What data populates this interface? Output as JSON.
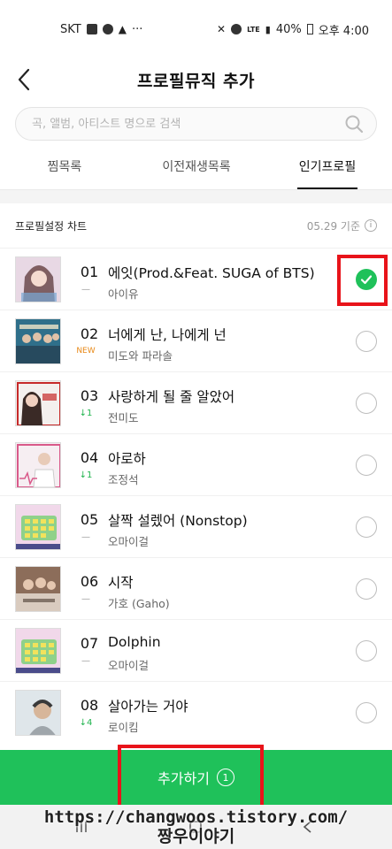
{
  "status_bar": {
    "carrier": "SKT",
    "left_dots": "···",
    "lte": "LTE",
    "battery": "40%",
    "time": "오후 4:00"
  },
  "header": {
    "title": "프로필뮤직 추가"
  },
  "search": {
    "placeholder": "곡, 앨범, 아티스트 명으로 검색"
  },
  "tabs": [
    {
      "label": "찜목록",
      "active": false
    },
    {
      "label": "이전재생목록",
      "active": false
    },
    {
      "label": "인기프로필",
      "active": true
    }
  ],
  "chart": {
    "title": "프로필설정 차트",
    "date": "05.29 기준",
    "info": "i"
  },
  "songs": [
    {
      "rank": "01",
      "change": "—",
      "change_type": "same",
      "title": "에잇(Prod.&Feat. SUGA of BTS)",
      "artist": "아이유",
      "selected": true
    },
    {
      "rank": "02",
      "change": "NEW",
      "change_type": "new",
      "title": "너에게 난, 나에게 넌",
      "artist": "미도와 파라솔",
      "selected": false
    },
    {
      "rank": "03",
      "change": "↓1",
      "change_type": "down",
      "title": "사랑하게 될 줄 알았어",
      "artist": "전미도",
      "selected": false
    },
    {
      "rank": "04",
      "change": "↓1",
      "change_type": "down",
      "title": "아로하",
      "artist": "조정석",
      "selected": false
    },
    {
      "rank": "05",
      "change": "—",
      "change_type": "same",
      "title": "살짝 설렜어 (Nonstop)",
      "artist": "오마이걸",
      "selected": false
    },
    {
      "rank": "06",
      "change": "—",
      "change_type": "same",
      "title": "시작",
      "artist": "가호 (Gaho)",
      "selected": false
    },
    {
      "rank": "07",
      "change": "—",
      "change_type": "same",
      "title": "Dolphin",
      "artist": "오마이걸",
      "selected": false
    },
    {
      "rank": "08",
      "change": "↓4",
      "change_type": "down",
      "title": "살아가는 거야",
      "artist": "로이킴",
      "selected": false
    }
  ],
  "add_button": {
    "label": "추가하기",
    "count": "1"
  },
  "watermark": {
    "line1": "https://changwoos.tistory.com/",
    "line2": "짱우이야기"
  },
  "colors": {
    "accent_green": "#1fc15a",
    "highlight_red": "#e8131a",
    "change_up": "#1fb34d",
    "new_badge": "#e88a1a"
  }
}
